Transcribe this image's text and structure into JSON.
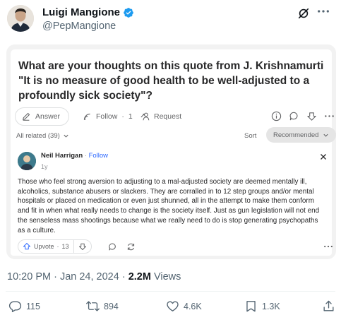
{
  "tweet": {
    "author_name": "Luigi Mangione",
    "author_handle": "@PepMangione",
    "timestamp": "10:20 PM · Jan 24, 2024 · ",
    "views_count": "2.2M",
    "views_label": " Views"
  },
  "quora": {
    "question": "What are your thoughts on this quote from J. Krishnamurti \"It is no measure of good health to be well-adjusted to a profoundly sick society\"?",
    "answer_label": "Answer",
    "follow_label": "Follow",
    "follow_count": "1",
    "request_label": "Request",
    "all_related": "All related (39)",
    "sort_label": "Sort",
    "sort_value": "Recommended",
    "answerer_name": "Neil Harrigan",
    "answerer_follow": "Follow",
    "answer_age": "1y",
    "answer_text": "Those who feel strong aversion to adjusting to a mal-adjusted society are deemed mentally ill, alcoholics, substance abusers or slackers. They are corralled in to 12 step groups and/or mental hospitals or placed on medication or even just shunned, all in the attempt to make them conform and fit in when what really needs to change is the society itself. Just as gun legislation will not end the senseless mass shootings because what we really need to do is stop generating psychopaths as a culture.",
    "upvote_label": "Upvote",
    "upvote_count": "13"
  },
  "engagement": {
    "replies": "115",
    "reposts": "894",
    "likes": "4.6K",
    "bookmarks": "1.3K"
  },
  "colors": {
    "verified": "#1d9bf0",
    "quora_link": "#2e69ff",
    "muted": "#536471"
  },
  "icons": [
    "verified-icon",
    "grok-icon",
    "more-icon",
    "pencil-icon",
    "follow-signal-icon",
    "request-icon",
    "info-icon",
    "comment-icon",
    "downvote-icon",
    "close-icon",
    "upvote-icon",
    "share-icon",
    "reply-icon",
    "repost-icon",
    "like-icon",
    "bookmark-icon"
  ]
}
